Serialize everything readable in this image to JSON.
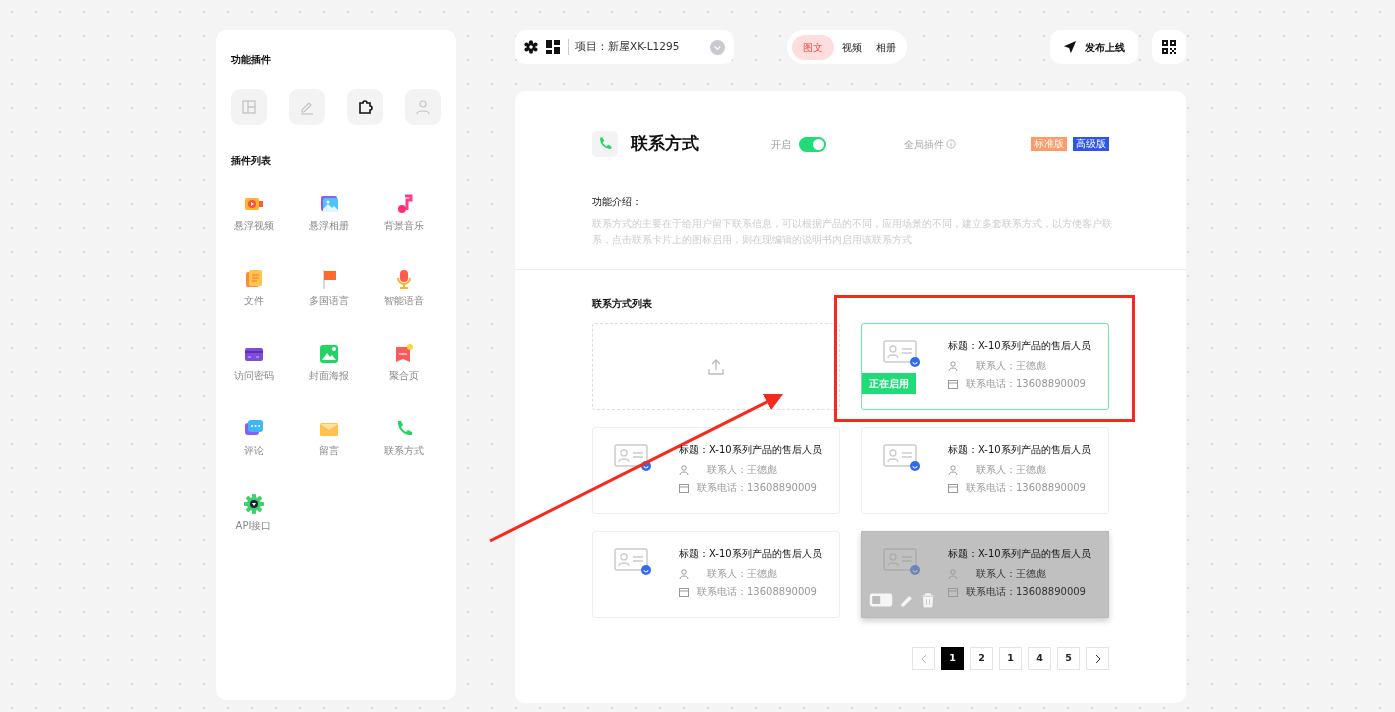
{
  "sidebar": {
    "tools_title": "功能插件",
    "tools": [
      {
        "selected": false
      },
      {
        "selected": false
      },
      {
        "selected": true
      },
      {
        "selected": false
      }
    ],
    "plugins_title": "插件列表",
    "plugins": [
      {
        "label": "悬浮视频"
      },
      {
        "label": "悬浮相册"
      },
      {
        "label": "背景音乐"
      },
      {
        "label": "文件"
      },
      {
        "label": "多国语言"
      },
      {
        "label": "智能语音"
      },
      {
        "label": "访问密码"
      },
      {
        "label": "封面海报"
      },
      {
        "label": "聚合页"
      },
      {
        "label": "评论"
      },
      {
        "label": "留言"
      },
      {
        "label": "联系方式"
      },
      {
        "label": "API接口"
      }
    ]
  },
  "toolbar": {
    "project": "项目：新屋XK-L1295",
    "tabs": [
      {
        "label": "图文",
        "selected": true
      },
      {
        "label": "视频",
        "selected": false
      },
      {
        "label": "相册",
        "selected": false
      }
    ],
    "publish": "发布上线"
  },
  "plugin": {
    "title": "联系方式",
    "switch_label": "开启",
    "on": true,
    "global_label": "全局插件",
    "badges": [
      {
        "label": "标准版",
        "color": "#ff9966"
      },
      {
        "label": "高级版",
        "color": "#2f54eb"
      }
    ],
    "intro_title": "功能介绍：",
    "intro": "联系方式的主要在于给用户留下联系信息，可以根据产品的不同，应用场景的不同，建立多套联系方式，以方便客户联系，点击联系卡片上的图标启用，则在现编辑的说明书内启用该联系方式"
  },
  "list": {
    "title": "联系方式列表",
    "cards": [
      {
        "kind": "upload"
      },
      {
        "kind": "contact",
        "title": "标题：X-10系列产品的售后人员",
        "person": "联系人：王德彪",
        "phone": "联系电话：13608890009",
        "active": true,
        "active_label": "正在启用",
        "hovered": false
      },
      {
        "kind": "contact",
        "title": "标题：X-10系列产品的售后人员",
        "person": "联系人：王德彪",
        "phone": "联系电话：13608890009",
        "active": false,
        "hovered": false
      },
      {
        "kind": "contact",
        "title": "标题：X-10系列产品的售后人员",
        "person": "联系人：王德彪",
        "phone": "联系电话：13608890009",
        "active": false,
        "hovered": false
      },
      {
        "kind": "contact",
        "title": "标题：X-10系列产品的售后人员",
        "person": "联系人：王德彪",
        "phone": "联系电话：13608890009",
        "active": false,
        "hovered": false
      },
      {
        "kind": "contact",
        "title": "标题：X-10系列产品的售后人员",
        "person": "联系人：王德彪",
        "phone": "联系电话：13608890009",
        "active": false,
        "hovered": true
      }
    ]
  },
  "pagination": {
    "pages": [
      {
        "label": "1",
        "selected": true
      },
      {
        "label": "2",
        "selected": false
      },
      {
        "label": "1",
        "selected": false
      },
      {
        "label": "4",
        "selected": false
      },
      {
        "label": "5",
        "selected": false
      }
    ]
  }
}
